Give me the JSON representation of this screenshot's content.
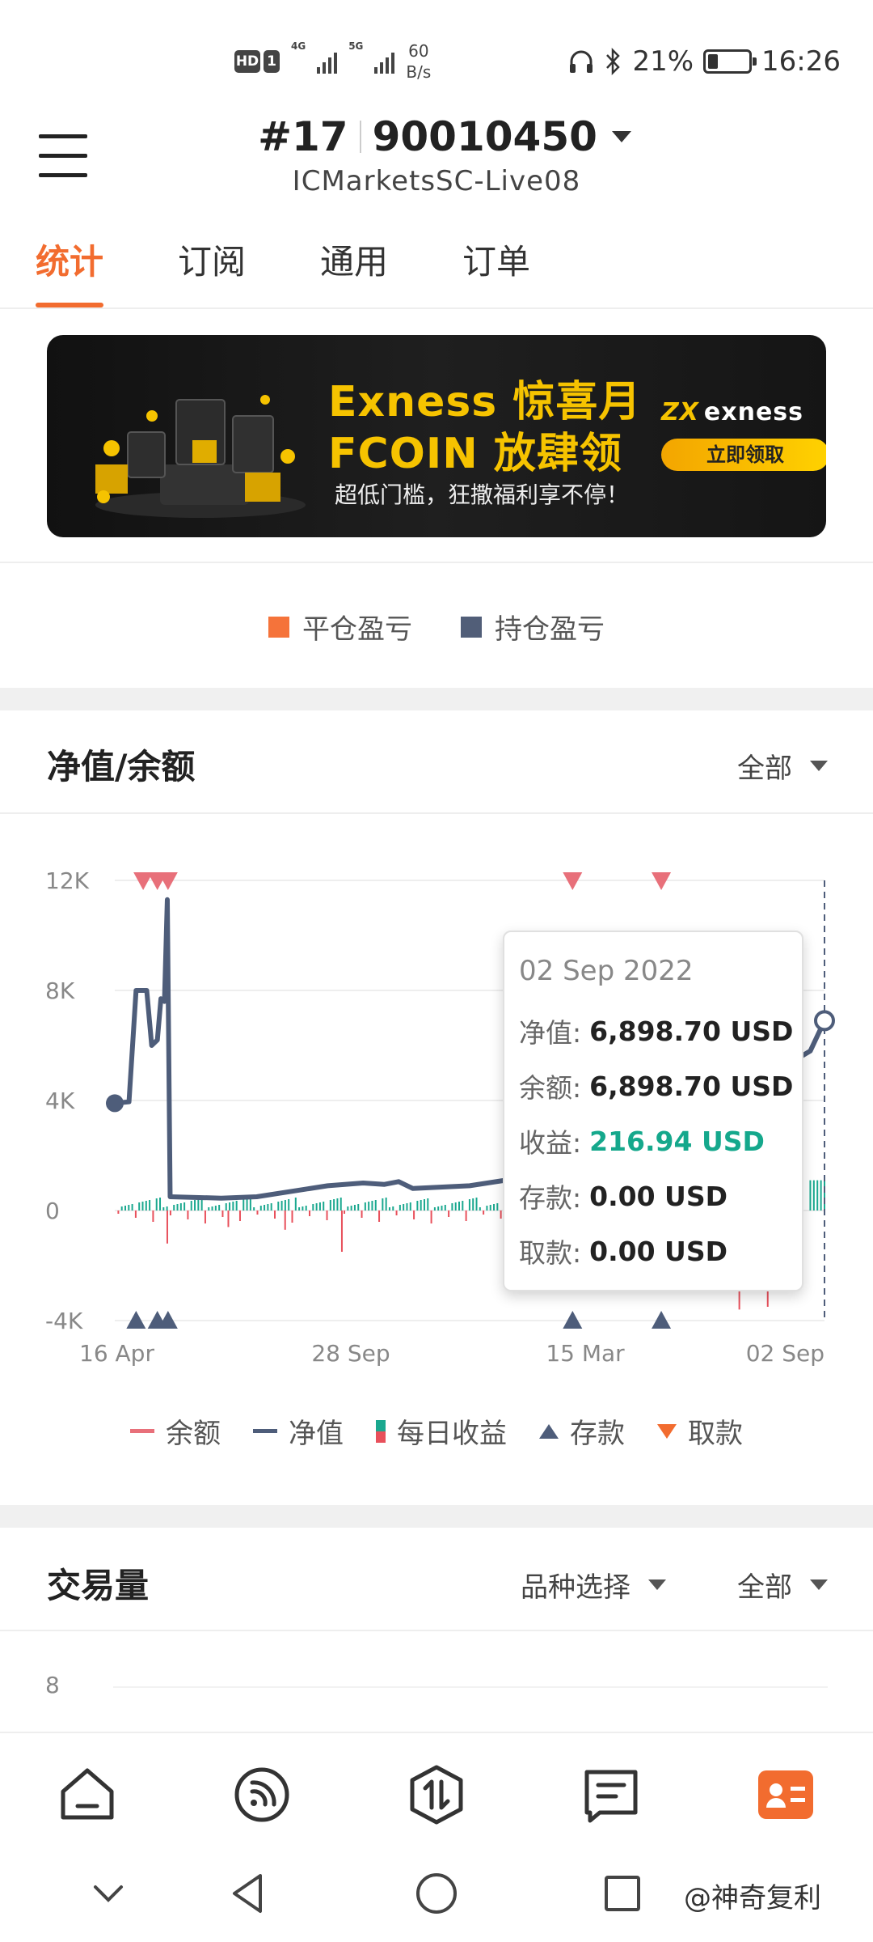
{
  "status_bar": {
    "hd_badge": "HD",
    "hd_sub": "1",
    "net1": "4G",
    "net2": "5G",
    "speed_value": "60",
    "speed_unit": "B/s",
    "battery": "21%",
    "time": "16:26",
    "battery_level": 0.21
  },
  "header": {
    "account_prefix": "#17",
    "account_number": "90010450",
    "server": "ICMarketsSC-Live08"
  },
  "tabs": [
    {
      "label": "统计",
      "active": true
    },
    {
      "label": "订阅",
      "active": false
    },
    {
      "label": "通用",
      "active": false
    },
    {
      "label": "订单",
      "active": false
    }
  ],
  "banner": {
    "line1": "Exness 惊喜月",
    "line2": "FCOIN 放肆领",
    "line3": "超低门槛，狂撒福利享不停！",
    "logo": "exness",
    "cta": "立即领取"
  },
  "pnl_legend": [
    {
      "label": "平仓盈亏",
      "color": "#f5733a"
    },
    {
      "label": "持仓盈亏",
      "color": "#515e78"
    }
  ],
  "equity_section": {
    "title": "净值/余额",
    "range_selector": "全部"
  },
  "chart_data": {
    "type": "line",
    "y_ticks": [
      "12K",
      "8K",
      "4K",
      "0",
      "-4K"
    ],
    "y_values": [
      12000,
      8000,
      4000,
      0,
      -4000
    ],
    "x_ticks": [
      "16 Apr",
      "28 Sep",
      "15 Mar",
      "02 Sep"
    ],
    "ylim": [
      -4000,
      12000
    ],
    "grid": true,
    "equity_points": [
      [
        0,
        3900
      ],
      [
        0.02,
        3950
      ],
      [
        0.03,
        8000
      ],
      [
        0.045,
        8000
      ],
      [
        0.052,
        6000
      ],
      [
        0.06,
        6200
      ],
      [
        0.065,
        7700
      ],
      [
        0.07,
        7600
      ],
      [
        0.074,
        11300
      ],
      [
        0.078,
        500
      ],
      [
        0.15,
        450
      ],
      [
        0.2,
        500
      ],
      [
        0.25,
        700
      ],
      [
        0.3,
        900
      ],
      [
        0.35,
        1000
      ],
      [
        0.38,
        950
      ],
      [
        0.4,
        1050
      ],
      [
        0.42,
        800
      ],
      [
        0.5,
        900
      ],
      [
        0.55,
        1100
      ],
      [
        0.6,
        1300
      ],
      [
        0.65,
        1500
      ],
      [
        0.68,
        1700
      ],
      [
        0.7,
        1500
      ],
      [
        0.98,
        5800
      ],
      [
        1.0,
        6900
      ]
    ],
    "series": [
      {
        "name": "余额",
        "color": "#e8707a"
      },
      {
        "name": "净值",
        "color": "#4e5d7a"
      },
      {
        "name": "每日收益",
        "colors": [
          "#1aa88f",
          "#e8505b"
        ]
      },
      {
        "name": "存款",
        "color": "#4e5d7a"
      },
      {
        "name": "取款",
        "color": "#f26c2f"
      }
    ],
    "deposit_markers_x": [
      0.03,
      0.06,
      0.075,
      0.645,
      0.77
    ],
    "withdrawal_markers_x": [
      0.04,
      0.06,
      0.075,
      0.645,
      0.77
    ]
  },
  "tooltip": {
    "date": "02 Sep 2022",
    "rows": [
      {
        "label": "净值:",
        "value": "6,898.70 USD",
        "positive": false
      },
      {
        "label": "余额:",
        "value": "6,898.70 USD",
        "positive": false
      },
      {
        "label": "收益:",
        "value": "216.94 USD",
        "positive": true
      },
      {
        "label": "存款:",
        "value": "0.00 USD",
        "positive": false
      },
      {
        "label": "取款:",
        "value": "0.00 USD",
        "positive": false
      }
    ]
  },
  "volume_section": {
    "title": "交易量",
    "symbol_selector": "品种选择",
    "range_selector": "全部",
    "y_tick_top": "8"
  },
  "watermark": "@神奇复利",
  "colors": {
    "accent": "#f26c2f",
    "equity": "#4e5d7a",
    "balance": "#e8707a",
    "profit": "#15a88c"
  }
}
